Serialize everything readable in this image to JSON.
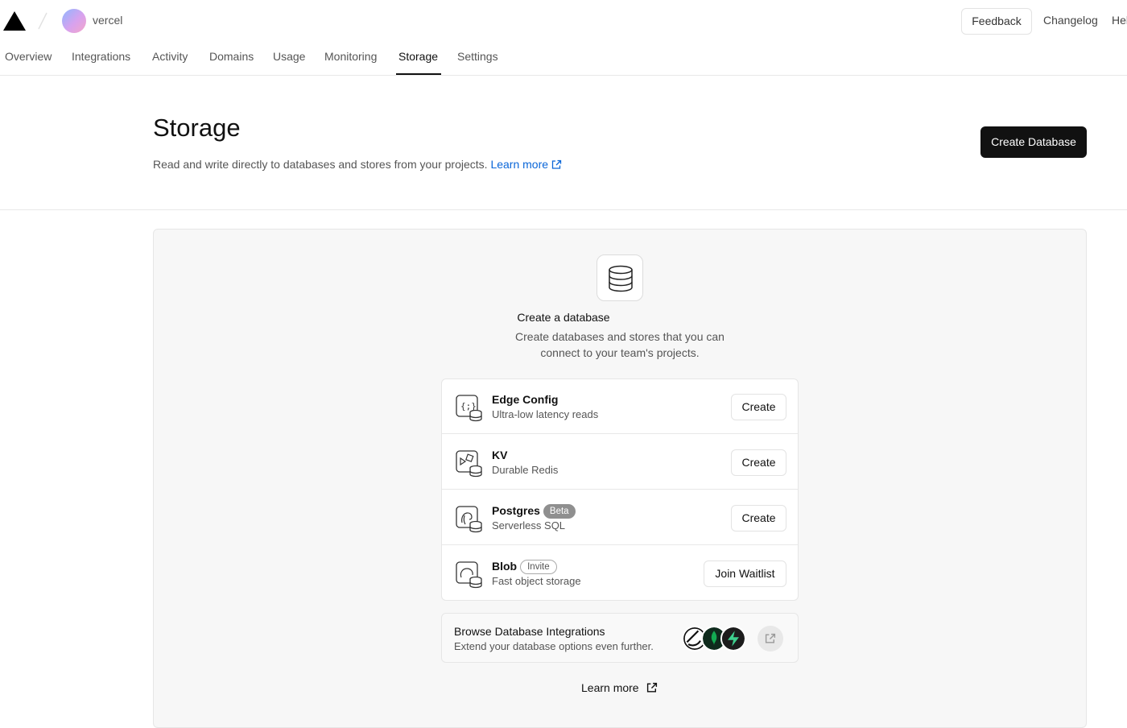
{
  "header": {
    "logo_icon": "vercel-triangle-icon",
    "team_name": "vercel",
    "feedback_label": "Feedback",
    "changelog_label": "Changelog",
    "help_label": "Help"
  },
  "tabs": [
    {
      "label": "Overview",
      "active": false
    },
    {
      "label": "Integrations",
      "active": false
    },
    {
      "label": "Activity",
      "active": false
    },
    {
      "label": "Domains",
      "active": false
    },
    {
      "label": "Usage",
      "active": false
    },
    {
      "label": "Monitoring",
      "active": false
    },
    {
      "label": "Storage",
      "active": true
    },
    {
      "label": "Settings",
      "active": false
    }
  ],
  "page": {
    "title": "Storage",
    "description": "Read and write directly to databases and stores from your projects.",
    "learn_more": "Learn more",
    "create_button": "Create Database"
  },
  "empty_state": {
    "icon": "database-icon",
    "title": "Create a database",
    "description": "Create databases and stores that you can connect to your team's projects."
  },
  "databases": [
    {
      "name": "Edge Config",
      "subtitle": "Ultra-low latency reads",
      "badge": "",
      "action": "Create",
      "icon": "edge-config-icon"
    },
    {
      "name": "KV",
      "subtitle": "Durable Redis",
      "badge": "",
      "action": "Create",
      "icon": "kv-icon"
    },
    {
      "name": "Postgres",
      "subtitle": "Serverless SQL",
      "badge": "Beta",
      "action": "Create",
      "icon": "postgres-icon"
    },
    {
      "name": "Blob",
      "subtitle": "Fast object storage",
      "badge": "Invite",
      "action": "Join Waitlist",
      "icon": "blob-icon"
    }
  ],
  "browse": {
    "title": "Browse Database Integrations",
    "subtitle": "Extend your database options even further.",
    "logos": [
      "planetscale-icon",
      "mongodb-icon",
      "supabase-icon"
    ]
  },
  "footer_link": "Learn more",
  "colors": {
    "accent_link": "#0a66d8",
    "primary_button": "#111111",
    "beta_badge": "#8f8f8f"
  }
}
